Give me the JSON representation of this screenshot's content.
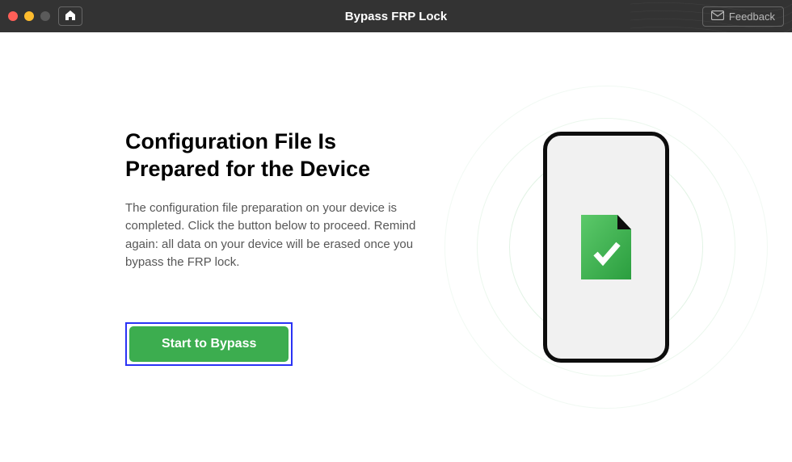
{
  "titlebar": {
    "title": "Bypass FRP Lock",
    "feedback_label": "Feedback"
  },
  "main": {
    "heading": "Configuration File Is Prepared for the Device",
    "description": "The configuration file preparation on your device is completed. Click the button below to proceed. Remind again: all data on your device will be erased once you bypass the FRP lock.",
    "action_label": "Start to Bypass"
  },
  "colors": {
    "accent_green": "#3cad4f",
    "focus_blue": "#2a33f5"
  }
}
